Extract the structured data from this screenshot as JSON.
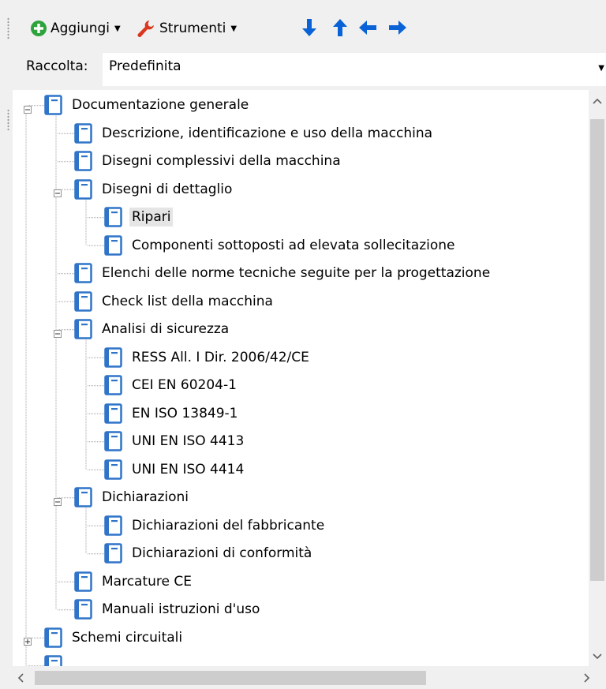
{
  "toolbar": {
    "add_label": "Aggiungi",
    "tools_label": "Strumenti"
  },
  "collection": {
    "label": "Raccolta:",
    "value": "Predefinita"
  },
  "tree": {
    "items": [
      {
        "label": "Documentazione generale",
        "level": 0,
        "expander": "minus"
      },
      {
        "label": "Descrizione, identificazione e uso della macchina",
        "level": 1
      },
      {
        "label": "Disegni complessivi della macchina",
        "level": 1
      },
      {
        "label": "Disegni di dettaglio",
        "level": 1,
        "expander": "minus"
      },
      {
        "label": "Ripari",
        "level": 2,
        "selected": true
      },
      {
        "label": "Componenti sottoposti ad elevata sollecitazione",
        "level": 2
      },
      {
        "label": "Elenchi delle norme tecniche seguite per la progettazione",
        "level": 1
      },
      {
        "label": "Check list della macchina",
        "level": 1
      },
      {
        "label": "Analisi di sicurezza",
        "level": 1,
        "expander": "minus"
      },
      {
        "label": "RESS All. I Dir. 2006/42/CE",
        "level": 2
      },
      {
        "label": "CEI EN 60204-1",
        "level": 2
      },
      {
        "label": "EN ISO 13849-1",
        "level": 2
      },
      {
        "label": "UNI EN ISO 4413",
        "level": 2
      },
      {
        "label": "UNI EN ISO 4414",
        "level": 2
      },
      {
        "label": "Dichiarazioni",
        "level": 1,
        "expander": "minus"
      },
      {
        "label": "Dichiarazioni del fabbricante",
        "level": 2
      },
      {
        "label": "Dichiarazioni di conformità",
        "level": 2
      },
      {
        "label": "Marcature CE",
        "level": 1
      },
      {
        "label": "Manuali istruzioni d'uso",
        "level": 1
      },
      {
        "label": "Schemi circuitali",
        "level": 0,
        "expander": "plus"
      },
      {
        "label": "",
        "level": 0
      }
    ]
  },
  "colors": {
    "add_green": "#2ea33d",
    "tools_red": "#d9381e",
    "arrow_blue": "#0a63d6",
    "icon_blue": "#2f74c8",
    "selection_gray": "#e5e5e5"
  },
  "icons": {
    "add": "plus-circle-icon",
    "tools": "wrench-icon",
    "move_down": "arrow-down-icon",
    "move_up": "arrow-up-icon",
    "move_left": "arrow-left-icon",
    "move_right": "arrow-right-icon",
    "node": "document-icon"
  }
}
